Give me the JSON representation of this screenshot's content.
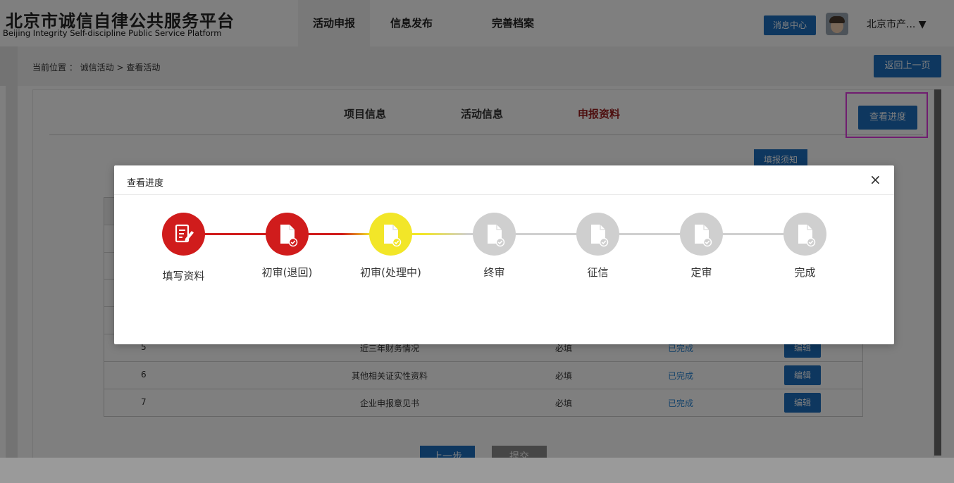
{
  "header": {
    "logo_zh": "北京市诚信自律公共服务平台",
    "logo_en": "Beijing Integrity Self-discipline Public Service Platform",
    "nav": [
      "活动申报",
      "信息发布",
      "完善档案"
    ],
    "message_center": "消息中心",
    "user": "北京市产... ▼"
  },
  "breadcrumb": {
    "text": "当前位置 ： 诚信活动 > 查看活动",
    "back_button": "返回上一页"
  },
  "content": {
    "tabs": [
      "项目信息",
      "活动信息",
      "申报资料"
    ],
    "active_tab": "申报资料",
    "progress_button": "查看进度",
    "notice_button": "填报须知",
    "rows": [
      {
        "no": "5",
        "name": "近三年财务情况",
        "required": "必填",
        "status": "已完成",
        "action": "编辑"
      },
      {
        "no": "6",
        "name": "其他相关证实性资料",
        "required": "必填",
        "status": "已完成",
        "action": "编辑"
      },
      {
        "no": "7",
        "name": "企业申报意见书",
        "required": "必填",
        "status": "已完成",
        "action": "编辑"
      }
    ],
    "prev_button": "上一步",
    "submit_button": "提交"
  },
  "modal": {
    "title": "查看进度",
    "close": "×",
    "steps": [
      {
        "label": "填写资料",
        "state": "done",
        "icon": "edit-form-icon"
      },
      {
        "label": "初审(退回)",
        "state": "done",
        "icon": "document-check-icon"
      },
      {
        "label": "初审(处理中)",
        "state": "current",
        "icon": "document-check-icon"
      },
      {
        "label": "终审",
        "state": "pending",
        "icon": "document-check-icon"
      },
      {
        "label": "征信",
        "state": "pending",
        "icon": "document-check-icon"
      },
      {
        "label": "定审",
        "state": "pending",
        "icon": "document-check-icon"
      },
      {
        "label": "完成",
        "state": "pending",
        "icon": "document-check-icon"
      }
    ]
  },
  "colors": {
    "primary": "#1d6fbf",
    "done": "#d01c1c",
    "current": "#f2e628",
    "pending": "#cfcfcf",
    "tab_active": "#9b1c1c",
    "status_link": "#2a86d6",
    "highlight": "#e13be0"
  }
}
